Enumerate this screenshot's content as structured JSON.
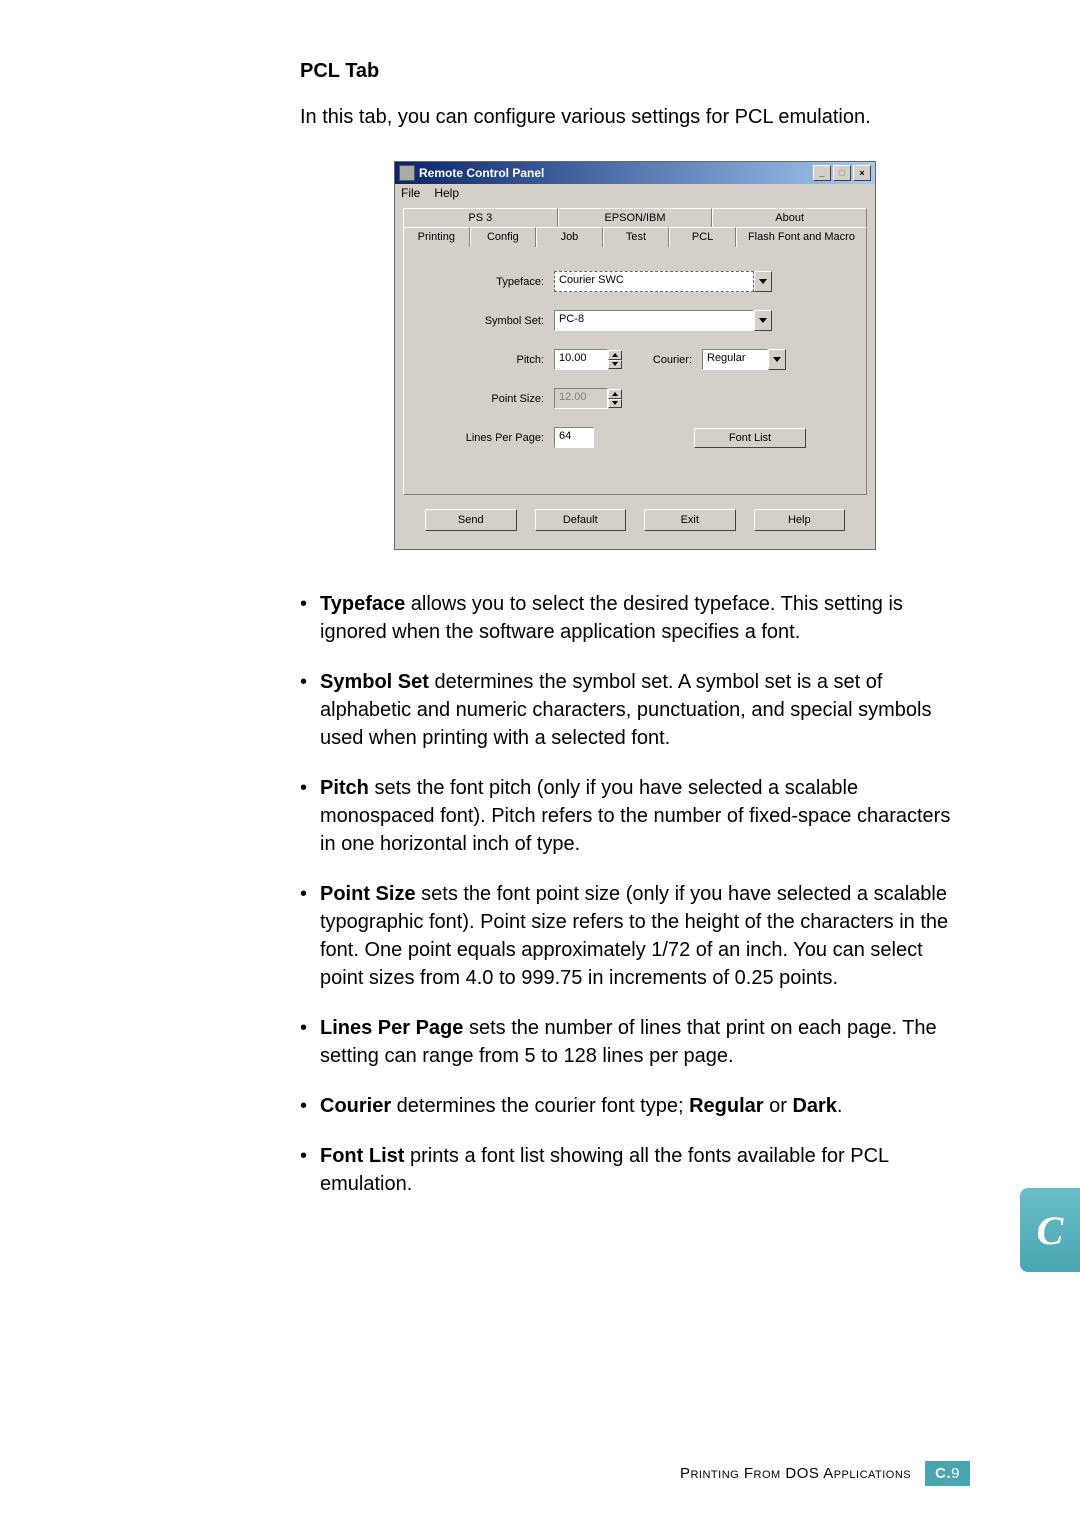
{
  "heading": "PCL Tab",
  "intro": "In this tab, you can configure various settings for PCL emulation.",
  "window": {
    "title": "Remote Control Panel",
    "menu": {
      "file": "File",
      "help": "Help"
    },
    "tabs_row1": {
      "ps3": "PS 3",
      "epson": "EPSON/IBM",
      "about": "About"
    },
    "tabs_row2": {
      "printing": "Printing",
      "config": "Config",
      "job": "Job",
      "test": "Test",
      "pcl": "PCL",
      "flash": "Flash Font and Macro"
    },
    "labels": {
      "typeface": "Typeface:",
      "symbol_set": "Symbol Set:",
      "pitch": "Pitch:",
      "courier": "Courier:",
      "point_size": "Point Size:",
      "lines_per_page": "Lines Per Page:"
    },
    "values": {
      "typeface": "Courier SWC",
      "symbol_set": "PC-8",
      "pitch": "10.00",
      "courier": "Regular",
      "point_size": "12.00",
      "lines_per_page": "64"
    },
    "buttons": {
      "font_list": "Font List",
      "send": "Send",
      "default": "Default",
      "exit": "Exit",
      "help": "Help"
    }
  },
  "bullets": {
    "typeface": {
      "term": "Typeface",
      "text": " allows you to select the desired typeface. This setting is ignored when the software application specifies a font."
    },
    "symbol_set": {
      "term": "Symbol Set",
      "text": " determines the symbol set. A symbol set is a set of alphabetic and numeric characters, punctuation, and special symbols used when printing with a selected font."
    },
    "pitch": {
      "term": "Pitch",
      "text": " sets the font pitch (only if you have selected a scalable monospaced font). Pitch refers to the number of fixed-space characters in one horizontal inch of type."
    },
    "point_size": {
      "term": "Point Size",
      "text": " sets the font point size (only if you have selected a scalable typographic font). Point size refers to the height of the characters in the font. One point equals approximately 1/72 of an inch. You can select point sizes from 4.0 to 999.75 in increments of 0.25 points."
    },
    "lines_per_page": {
      "term": "Lines Per Page",
      "text": " sets the number of lines that print on each page. The setting can range from 5 to 128 lines per page."
    },
    "courier": {
      "term": "Courier",
      "text1": " determines the courier font type; ",
      "r": "Regular",
      "text2": " or ",
      "d": "Dark",
      "text3": "."
    },
    "font_list": {
      "term": "Font List",
      "text": " prints a font list showing all the fonts available for PCL emulation."
    }
  },
  "side_tab": "C",
  "footer": {
    "text": "Printing From DOS Applications",
    "badge_c": "C.",
    "badge_num": "9"
  }
}
